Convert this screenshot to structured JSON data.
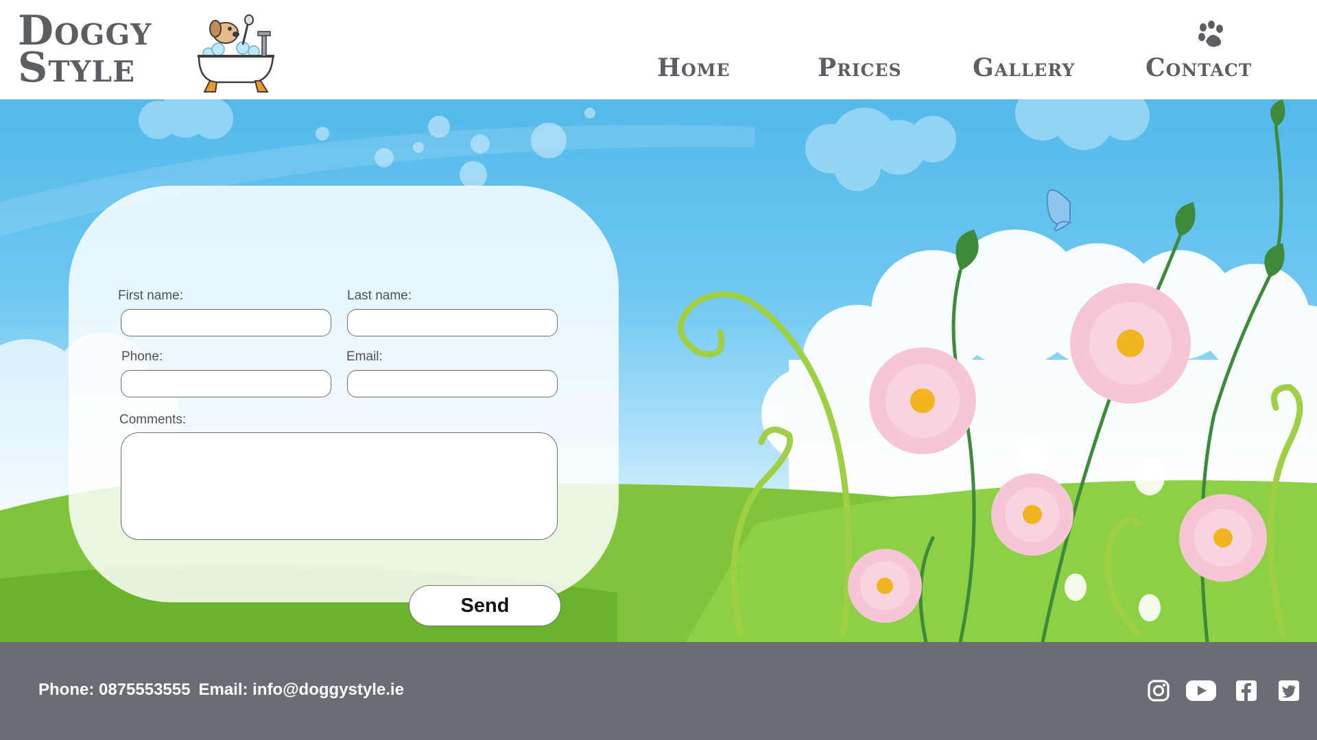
{
  "brand": {
    "line1": "Doggy",
    "line2": "Style"
  },
  "nav": {
    "home": "Home",
    "prices": "Prices",
    "gallery": "Gallery",
    "contact": "Contact"
  },
  "form": {
    "first_name_label": "First name:",
    "last_name_label": "Last name:",
    "phone_label": "Phone:",
    "email_label": "Email:",
    "comments_label": "Comments:",
    "first_name_value": "",
    "last_name_value": "",
    "phone_value": "",
    "email_value": "",
    "comments_value": "",
    "send_label": "Send"
  },
  "footer": {
    "phone": "Phone: 0875553555",
    "email": "Email: info@doggystyle.ie",
    "social_icons": [
      "instagram-icon",
      "youtube-icon",
      "facebook-icon",
      "twitter-icon"
    ]
  },
  "colors": {
    "text_gray": "#5b5f63",
    "footer_bg": "#6a6d74",
    "sky": "#54b9ea",
    "grass": "#7fc43a",
    "flower_pink": "#f7c6d6",
    "flower_center": "#f2b51d"
  }
}
